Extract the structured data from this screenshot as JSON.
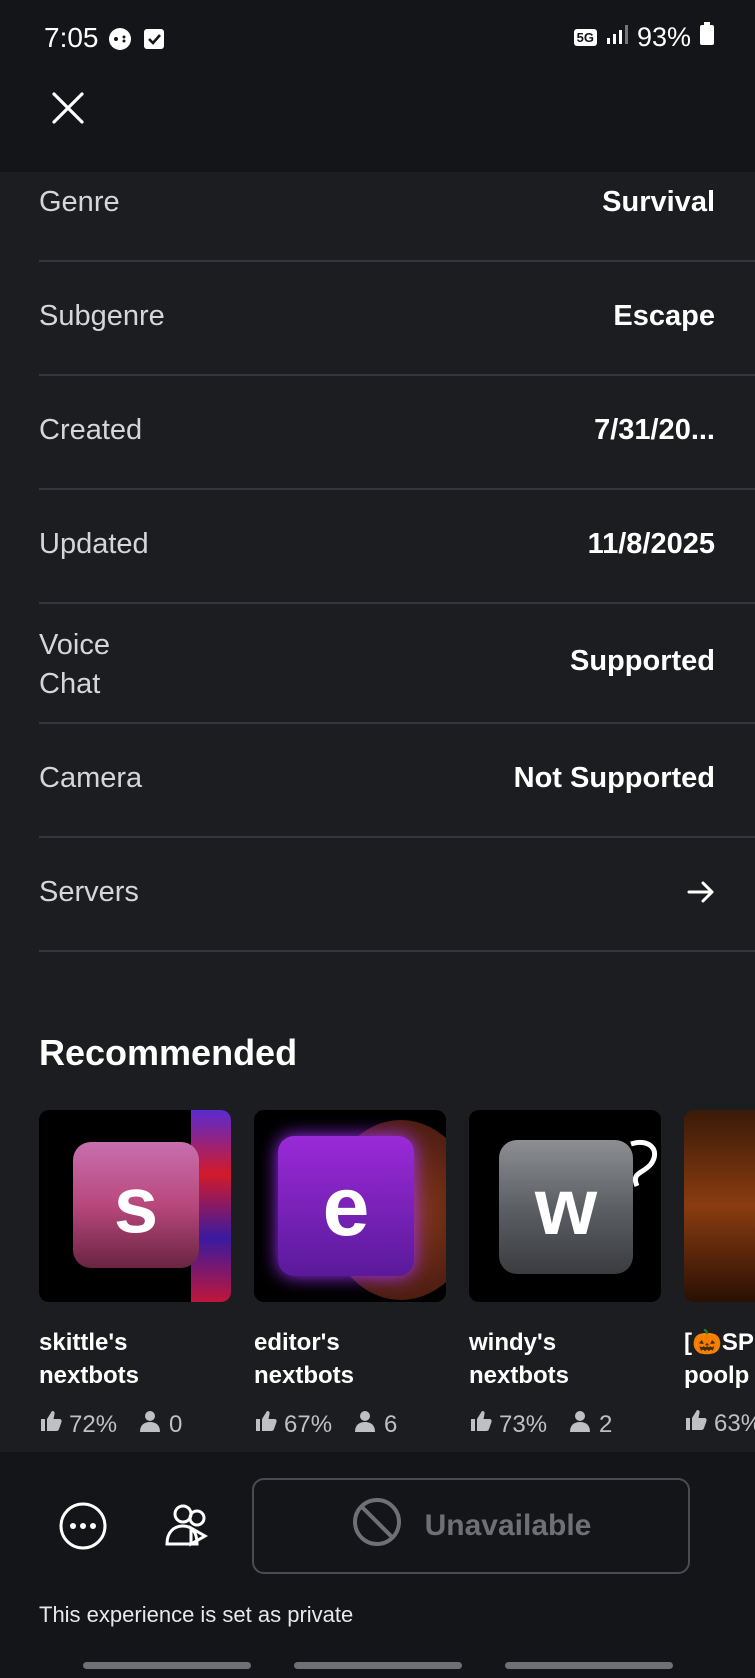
{
  "status_bar": {
    "time": "7:05",
    "network": "5G",
    "battery": "93%"
  },
  "details": [
    {
      "label": "Genre",
      "value": "Survival"
    },
    {
      "label": "Subgenre",
      "value": "Escape"
    },
    {
      "label": "Created",
      "value": "7/31/20..."
    },
    {
      "label": "Updated",
      "value": "11/8/2025"
    },
    {
      "label": "Voice\nChat",
      "value": "Supported"
    },
    {
      "label": "Camera",
      "value": "Not Supported"
    },
    {
      "label": "Servers",
      "value": ""
    }
  ],
  "recommended": {
    "title": "Recommended",
    "items": [
      {
        "letter": "s",
        "name": "skittle's\nnextbots",
        "rating": "72%",
        "players": "0"
      },
      {
        "letter": "e",
        "name": "editor's\nnextbots",
        "rating": "67%",
        "players": "6"
      },
      {
        "letter": "w",
        "name": "windy's\nnextbots",
        "rating": "73%",
        "players": "2"
      },
      {
        "letter": "",
        "name": "[🎃SP\npoolp",
        "rating": "63%",
        "players": ""
      }
    ]
  },
  "actions": {
    "unavailable_label": "Unavailable",
    "private_note": "This experience is set as private"
  },
  "colors": {
    "background": "#1c1d21",
    "header": "#141518",
    "divider": "#34363c"
  }
}
